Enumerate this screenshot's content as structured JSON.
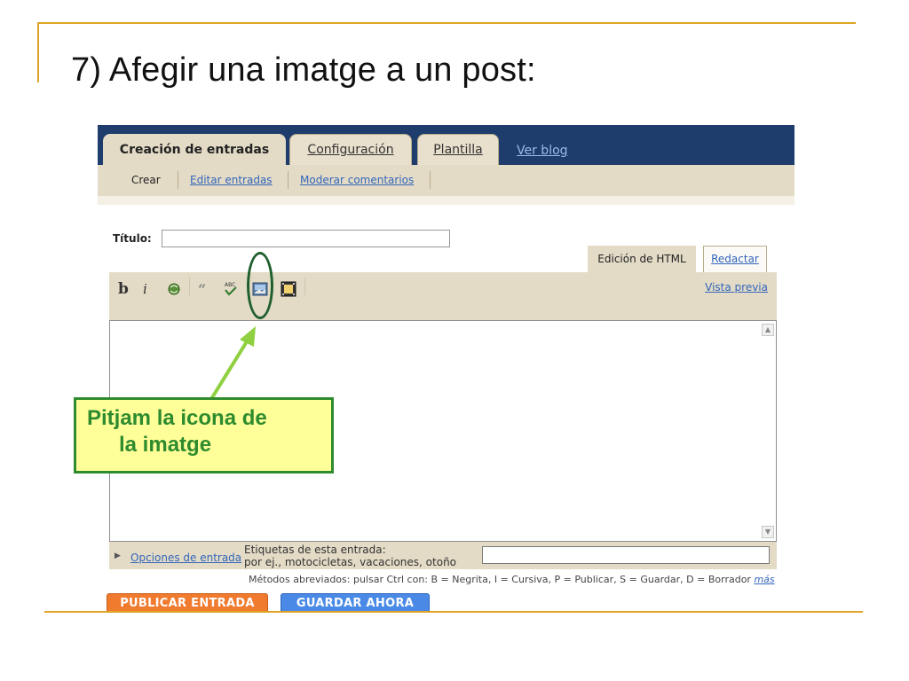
{
  "slide": {
    "title": "7) Afegir una imatge a un post:"
  },
  "main_tabs": [
    {
      "label": "Creación de entradas",
      "active": true
    },
    {
      "label": "Configuración",
      "active": false
    },
    {
      "label": "Plantilla",
      "active": false
    },
    {
      "label": "Ver blog",
      "active": false
    }
  ],
  "sub_tabs": [
    {
      "label": "Crear",
      "active": true
    },
    {
      "label": "Editar entradas",
      "active": false
    },
    {
      "label": "Moderar comentarios",
      "active": false
    }
  ],
  "post": {
    "title_label": "Título:",
    "title_value": ""
  },
  "editor": {
    "mode_tabs": {
      "html": "Edición de HTML",
      "compose": "Redactar"
    },
    "toolbar": {
      "bold": "b",
      "italic": "i",
      "quote": "“",
      "icons": [
        "link-icon",
        "quote-icon",
        "spellcheck-icon",
        "image-icon",
        "video-icon"
      ]
    },
    "preview": "Vista previa",
    "body": ""
  },
  "options": {
    "link": "Opciones de entrada",
    "labels_title": "Etiquetas de esta entrada:",
    "labels_hint": "por ej., motocicletas, vacaciones, otoño",
    "labels_value": ""
  },
  "shortcuts": {
    "text": "Métodos abreviados: pulsar Ctrl con: B = Negrita, I = Cursiva, P = Publicar, S = Guardar, D = Borrador",
    "more": "más"
  },
  "buttons": {
    "publish": "PUBLICAR ENTRADA",
    "save": "GUARDAR AHORA"
  },
  "callout": {
    "line1": "Pitjam la icona de",
    "line2": "la imatge"
  },
  "colors": {
    "accent_line": "#e0a526",
    "nav_bg": "#1e3c6c",
    "panel_bg": "#e3dbc6",
    "publish": "#f07a2e",
    "save": "#4a8ae6",
    "callout_border": "#2e8b2e",
    "callout_bg": "#ffff99"
  }
}
